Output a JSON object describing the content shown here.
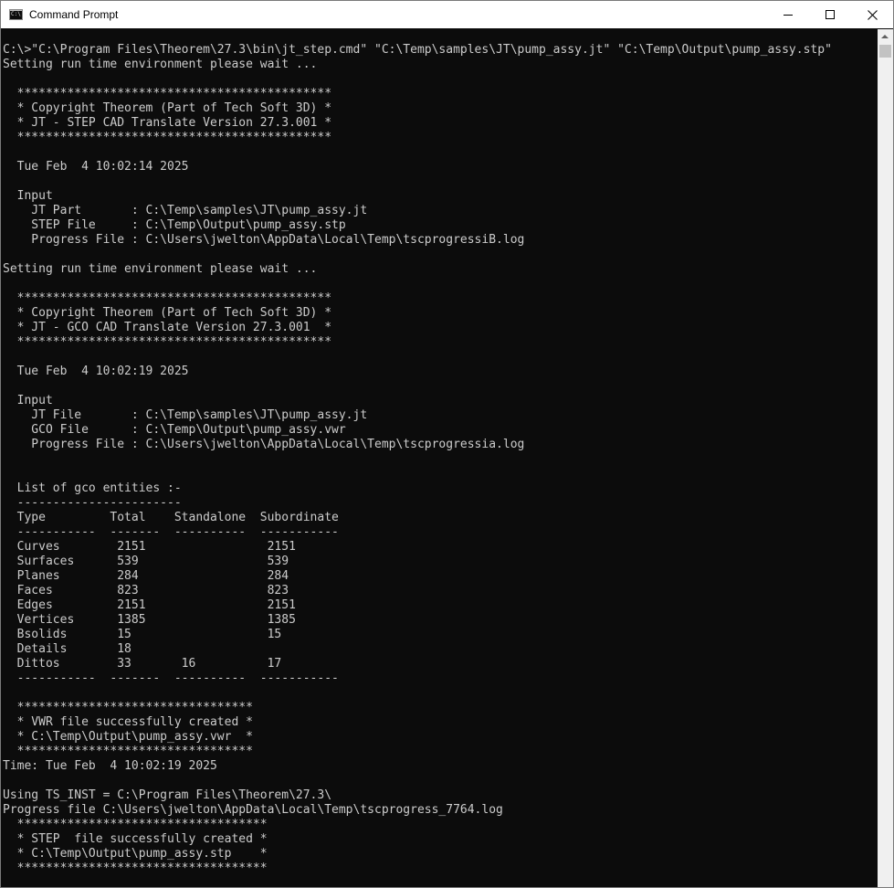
{
  "window": {
    "title": "Command Prompt",
    "icon": "console-app-icon",
    "icon_text": "C:\\",
    "controls": [
      "minimize-icon",
      "maximize-icon",
      "close-icon"
    ]
  },
  "console": {
    "lines": [
      "C:\\>\"C:\\Program Files\\Theorem\\27.3\\bin\\jt_step.cmd\" \"C:\\Temp\\samples\\JT\\pump_assy.jt\" \"C:\\Temp\\Output\\pump_assy.stp\"",
      "Setting run time environment please wait ...",
      "",
      "  ********************************************",
      "  * Copyright Theorem (Part of Tech Soft 3D) *",
      "  * JT - STEP CAD Translate Version 27.3.001 *",
      "  ********************************************",
      "",
      "  Tue Feb  4 10:02:14 2025",
      "",
      "  Input",
      "    JT Part       : C:\\Temp\\samples\\JT\\pump_assy.jt",
      "    STEP File     : C:\\Temp\\Output\\pump_assy.stp",
      "    Progress File : C:\\Users\\jwelton\\AppData\\Local\\Temp\\tscprogressiB.log",
      "",
      "Setting run time environment please wait ...",
      "",
      "  ********************************************",
      "  * Copyright Theorem (Part of Tech Soft 3D) *",
      "  * JT - GCO CAD Translate Version 27.3.001  *",
      "  ********************************************",
      "",
      "  Tue Feb  4 10:02:19 2025",
      "",
      "  Input",
      "    JT File       : C:\\Temp\\samples\\JT\\pump_assy.jt",
      "    GCO File      : C:\\Temp\\Output\\pump_assy.vwr",
      "    Progress File : C:\\Users\\jwelton\\AppData\\Local\\Temp\\tscprogressia.log",
      "",
      "",
      "  List of gco entities :-",
      "  -----------------------",
      "  Type         Total    Standalone  Subordinate",
      "  -----------  -------  ----------  -----------",
      "  Curves        2151                 2151",
      "  Surfaces      539                  539",
      "  Planes        284                  284",
      "  Faces         823                  823",
      "  Edges         2151                 2151",
      "  Vertices      1385                 1385",
      "  Bsolids       15                   15",
      "  Details       18",
      "  Dittos        33       16          17",
      "  -----------  -------  ----------  -----------",
      "",
      "  *********************************",
      "  * VWR file successfully created *",
      "  * C:\\Temp\\Output\\pump_assy.vwr  *",
      "  *********************************",
      "Time: Tue Feb  4 10:02:19 2025",
      "",
      "Using TS_INST = C:\\Program Files\\Theorem\\27.3\\",
      "Progress file C:\\Users\\jwelton\\AppData\\Local\\Temp\\tscprogress_7764.log",
      "  ***********************************",
      "  * STEP  file successfully created *",
      "  * C:\\Temp\\Output\\pump_assy.stp    *",
      "  ***********************************"
    ]
  }
}
